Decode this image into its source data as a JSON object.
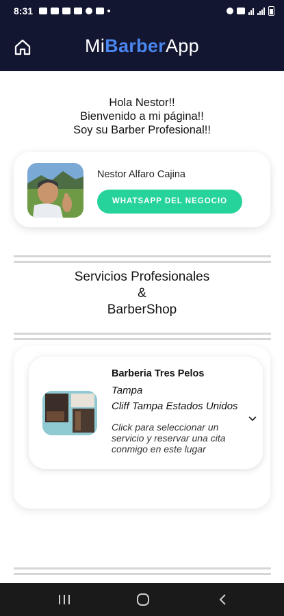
{
  "status_bar": {
    "time": "8:31"
  },
  "app_bar": {
    "title_prefix": "Mi",
    "title_brand": "Barber",
    "title_suffix": "App"
  },
  "greeting": {
    "line1": "Hola Nestor!!",
    "line2": "Bienvenido a mi página!!",
    "line3": "Soy su Barber Profesional!!"
  },
  "profile": {
    "name": "Nestor Alfaro Cajina",
    "whatsapp_button": "WHATSAPP DEL NEGOCIO"
  },
  "services_section": {
    "line1": "Servicios Profesionales",
    "line2": "&",
    "line3": "BarberShop"
  },
  "shop": {
    "name": "Barberia Tres Pelos",
    "city": "Tampa",
    "address": "Cliff Tampa Estados Unidos",
    "hint": "Click para seleccionar un servicio y reservar una cita conmigo en este lugar"
  },
  "colors": {
    "appbar_bg": "#131631",
    "brand_blue": "#4a86f0",
    "whatsapp_green": "#26d39b"
  },
  "icons": {
    "home": "home-icon",
    "expand": "chevron-down-icon",
    "nav_recents": "recents-icon",
    "nav_home": "nav-home-icon",
    "nav_back": "back-icon"
  }
}
